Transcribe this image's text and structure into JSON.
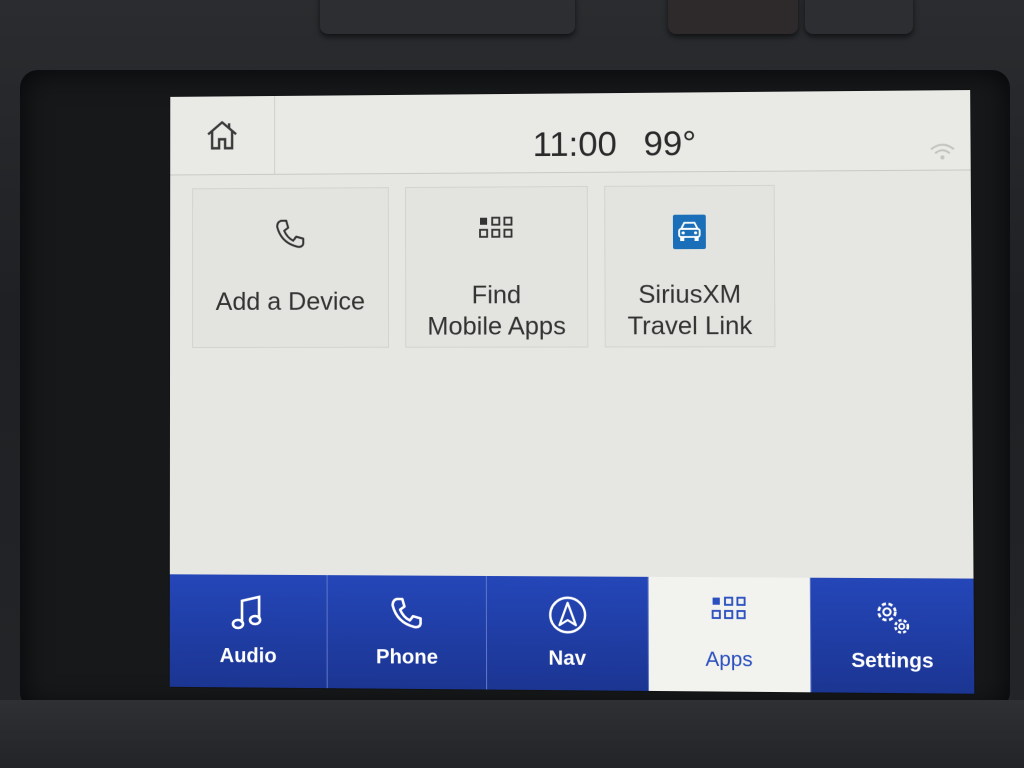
{
  "status": {
    "time": "11:00",
    "temperature": "99°"
  },
  "tiles": [
    {
      "label_line1": "Add a Device",
      "label_line2": "",
      "icon": "phone-icon"
    },
    {
      "label_line1": "Find",
      "label_line2": "Mobile Apps",
      "icon": "grid-icon"
    },
    {
      "label_line1": "SiriusXM",
      "label_line2": "Travel Link",
      "icon": "car-icon"
    }
  ],
  "nav": [
    {
      "label": "Audio",
      "icon": "music-note-icon",
      "active": false
    },
    {
      "label": "Phone",
      "icon": "phone-icon",
      "active": false
    },
    {
      "label": "Nav",
      "icon": "navigation-arrow-icon",
      "active": false
    },
    {
      "label": "Apps",
      "icon": "apps-grid-icon",
      "active": true
    },
    {
      "label": "Settings",
      "icon": "gears-icon",
      "active": false
    }
  ],
  "colors": {
    "nav_blue": "#2446b8",
    "active_text": "#2a4fbf",
    "screen_bg": "#e6e6e3",
    "sirius_icon": "#1a6fb8"
  }
}
